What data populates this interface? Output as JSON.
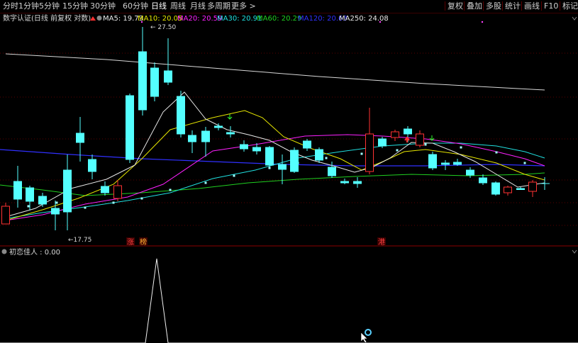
{
  "timeframes": [
    {
      "label": "分时",
      "active": false
    },
    {
      "label": "1分钟",
      "active": false
    },
    {
      "label": "5分钟",
      "active": false
    },
    {
      "label": "15分钟",
      "active": false
    },
    {
      "label": "30分钟",
      "active": false
    },
    {
      "label": "60分钟",
      "active": false
    },
    {
      "label": "日线",
      "active": true
    },
    {
      "label": "周线",
      "active": false
    },
    {
      "label": "月线",
      "active": false
    },
    {
      "label": "多周期",
      "active": false
    },
    {
      "label": "更多 >",
      "active": false
    }
  ],
  "right_toolbar": [
    "复权",
    "叠加",
    "多股",
    "统计",
    "画线",
    "F10",
    "标记"
  ],
  "close_symbol": "×",
  "main_legend": {
    "indicator_title": "数字认证(日线 前复权 对数)",
    "ma": [
      {
        "label": "MA5: 19.73",
        "color": "#e8e8e8"
      },
      {
        "label": "MA10: 20.05",
        "color": "#e6e600"
      },
      {
        "label": "MA20: 20.59",
        "color": "#ff20ff"
      },
      {
        "label": "MA30: 20.91",
        "color": "#20e0e0"
      },
      {
        "label": "MA60: 20.29",
        "color": "#20d020"
      },
      {
        "label": "MA120: 20.63",
        "color": "#3030ff"
      },
      {
        "label": "MA250: 24.08",
        "color": "#e8e8e8"
      }
    ]
  },
  "annotations": {
    "high_label": "27.50",
    "low_label": "17.75",
    "badges": [
      "涨",
      "榜",
      "港"
    ]
  },
  "sub_legend": {
    "indicator": "初恋佳人 : 0.00"
  },
  "colors": {
    "up": "#ff3232",
    "down": "#54ffff",
    "grid": "#5a0000",
    "ma5": "#e8e8e8",
    "ma10": "#e6e600",
    "ma20": "#ff20ff",
    "ma30": "#20e0e0",
    "ma60": "#20d020",
    "ma120": "#3030ff",
    "ma250": "#d8d8d8"
  }
}
